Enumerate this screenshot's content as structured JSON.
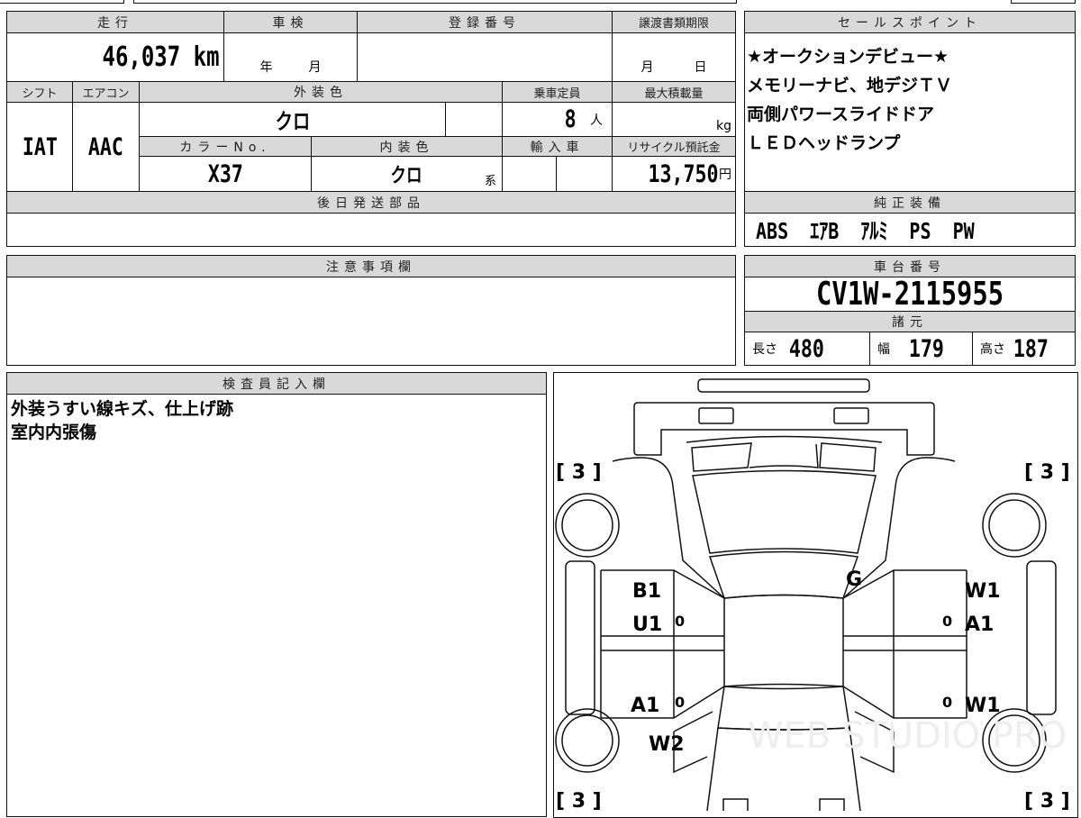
{
  "main_table": {
    "mileage_label": "走行",
    "mileage_value": "46,037",
    "mileage_unit": "km",
    "inspection_label": "車検",
    "inspection_year": "年",
    "inspection_month": "月",
    "registration_label": "登録番号",
    "registration_value": "",
    "transfer_deadline_label": "譲渡書類期限",
    "transfer_month": "月",
    "transfer_day": "日",
    "shift_label": "シフト",
    "shift_value": "IAT",
    "aircon_label": "エアコン",
    "aircon_value": "AAC",
    "exterior_color_label": "外装色",
    "exterior_color_value": "クロ",
    "capacity_label": "乗車定員",
    "capacity_value": "8",
    "capacity_unit": "人",
    "max_load_label": "最大積載量",
    "max_load_unit": "kg",
    "color_no_label": "カラーNo.",
    "color_no_value": "X37",
    "interior_color_label": "内装色",
    "interior_color_value": "クロ",
    "interior_color_suffix": "系",
    "import_label": "輸入車",
    "recycle_label": "リサイクル預託金",
    "recycle_value": "13,750",
    "recycle_unit": "円",
    "later_parts_label": "後日発送部品"
  },
  "notes": {
    "label": "注意事項欄"
  },
  "sales_points": {
    "label": "セールスポイント",
    "lines": [
      "★オークションデビュー★",
      "メモリーナビ、地デジＴＶ",
      "両側パワースライドドア",
      "ＬＥＤヘッドランプ"
    ]
  },
  "equipment": {
    "label": "純正装備",
    "value": "ABS  ｴｱB  ｱﾙﾐ  PS  PW"
  },
  "chassis": {
    "label": "車台番号",
    "value": "CV1W-2115955"
  },
  "specs": {
    "label": "諸元",
    "length_label": "長さ",
    "length": "480",
    "width_label": "幅",
    "width": "179",
    "height_label": "高さ",
    "height": "187"
  },
  "inspector": {
    "label": "検査員記入欄",
    "lines": [
      "外装うすい線キズ、仕上げ跡",
      "室内内張傷"
    ]
  },
  "diagram": {
    "tire_marks": [
      "[ 3 ]",
      "[ 3 ]",
      "[ 3 ]",
      "[ 3 ]"
    ],
    "marks": {
      "windshield": "G",
      "left_front_door_1": "B1",
      "left_front_door_2": "U1",
      "left_rear_door": "A1",
      "left_rear_fender": "W2",
      "right_front_door_1": "W1",
      "right_front_door_2": "A1",
      "right_rear_door": "W1",
      "zero": "0"
    },
    "watermark": "WEB STUDIO PRO"
  }
}
